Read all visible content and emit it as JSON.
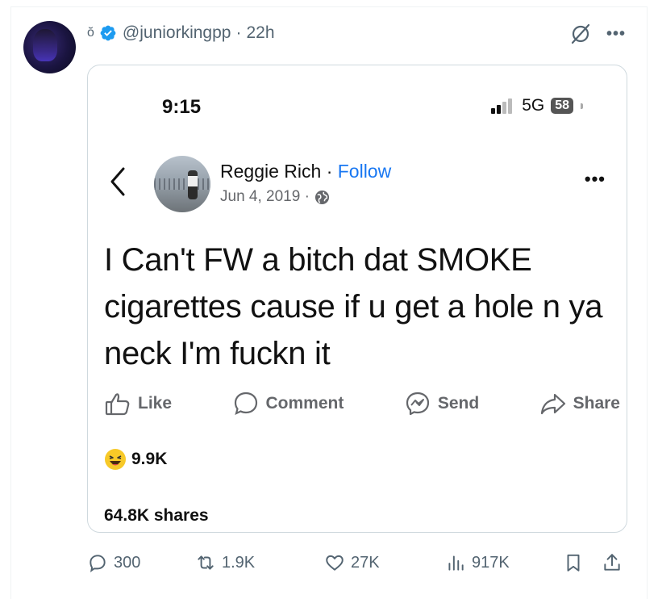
{
  "tweet": {
    "name_glyph": "ŏ",
    "handle": "@juniorkingpp",
    "separator": "·",
    "age": "22h",
    "more_label": "•••"
  },
  "embedded": {
    "phone_time": "9:15",
    "network": "5G",
    "battery": "58",
    "author_name": "Reggie Rich",
    "follow_sep": "·",
    "follow_label": "Follow",
    "post_date": "Jun 4, 2019 ·",
    "more_label": "•••",
    "post_text": "I Can't FW a bitch dat SMOKE cigarettes cause if u get a hole n ya neck I'm fuckn it",
    "actions": {
      "like": "Like",
      "comment": "Comment",
      "send": "Send",
      "share": "Share"
    },
    "reactions_count": "9.9K",
    "shares_text": "64.8K shares"
  },
  "tweet_actions": {
    "replies": "300",
    "reposts": "1.9K",
    "likes": "27K",
    "views": "917K"
  },
  "colors": {
    "verified": "#1d9bf0",
    "fb_blue": "#1877f2",
    "muted": "#536471"
  }
}
